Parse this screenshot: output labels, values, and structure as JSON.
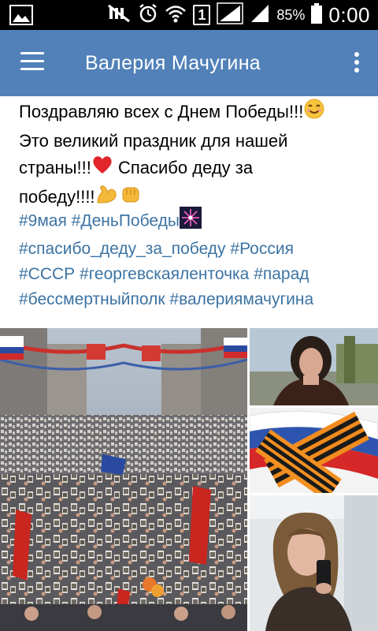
{
  "status_bar": {
    "battery_percent": "85%",
    "time": "0:00",
    "sim_slot": "1",
    "icons": [
      "gallery-icon",
      "mute-icon",
      "alarm-icon",
      "wifi-icon",
      "sim-1-icon",
      "signal-icon",
      "signal-icon-2",
      "battery-icon"
    ]
  },
  "app_bar": {
    "title": "Валерия Мачугина",
    "color": "#5181b8",
    "menu_icon": "hamburger-menu-icon",
    "more_icon": "more-vertical-icon"
  },
  "post": {
    "lines": [
      "Поздравляю всех с Днем Победы!!!",
      "Это великий праздник для нашей",
      "страны!!!",
      "Спасибо деду за",
      "победу!!!!"
    ],
    "emojis": [
      "smiling-face-emoji",
      "red-heart-emoji",
      "flexed-biceps-emoji",
      "oncoming-fist-emoji",
      "fireworks-emoji"
    ],
    "hashtags": [
      "#9мая",
      "#ДеньПобеды",
      "#спасибо_деду_за_победу",
      "#Россия",
      "#СССР",
      "#георгевскаяленточка",
      "#парад",
      "#бессмертныйполк",
      "#валериямачугина"
    ],
    "hashtag_color": "#3b73a3"
  },
  "photos": [
    {
      "subject": "immortal-regiment-march-crowd-photo"
    },
    {
      "subject": "girl-selfie-outdoors-photo"
    },
    {
      "subject": "st-george-ribbon-and-russian-flag-photo"
    },
    {
      "subject": "girl-mirror-selfie-photo"
    }
  ]
}
